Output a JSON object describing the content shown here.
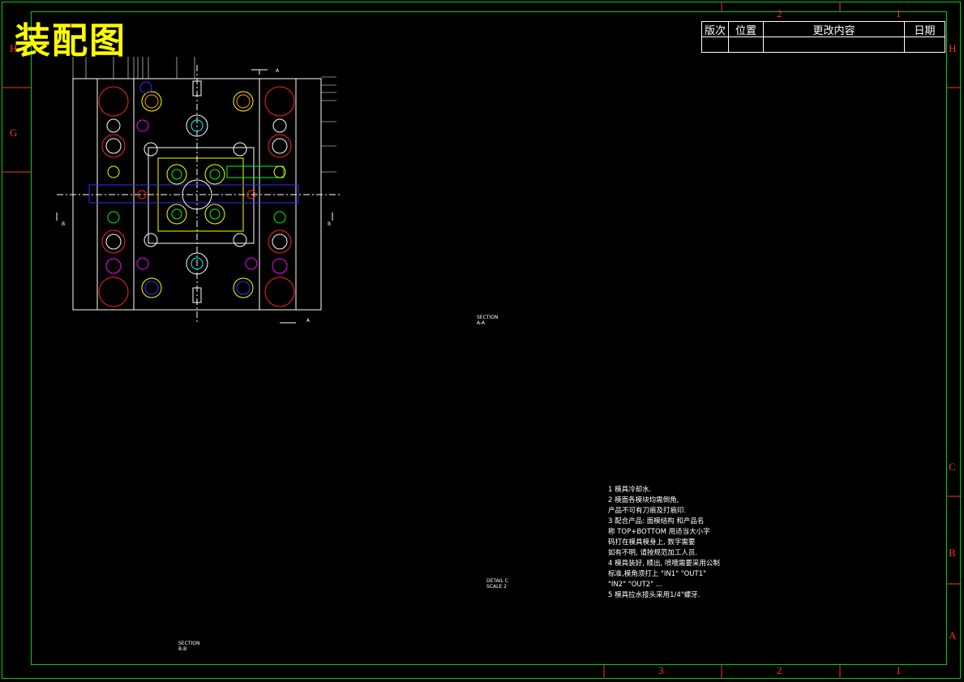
{
  "drawing_title": "装配图",
  "revision_header": [
    "版次",
    "位置",
    "更改内容",
    "日期"
  ],
  "zone_letters_left": [
    "H",
    "G"
  ],
  "zone_letters_right": [
    "H",
    "C",
    "B",
    "A"
  ],
  "zone_numbers_top": [
    "2",
    "1"
  ],
  "zone_numbers_bottom": [
    "3",
    "2",
    "1"
  ],
  "view_labels": {
    "section_aa": "SECTION\nA-A",
    "section_bb": "SECTION\nB-B",
    "detail_c": "DETAIL C\nSCALE 2"
  },
  "cut_markers": {
    "a": "A",
    "b": "B"
  },
  "notes": [
    "1  模具冷却水.",
    "2  模面各模块均需倒角,",
    "    产品不可有刀痕及打痕印.",
    "3  配合产品:   面模结构  和产品名",
    "    称 TOP+BOTTOM  用适当大小字",
    "    码打在模具模身上, 数字需要",
    "    如有不明, 请按规范加工人员.",
    "4  模具装好, 顺出, 喷哦需要采用公制",
    "    标准,模角须打上 \"IN1\" \"OUT1\"",
    "    \"IN2\" \"OUT2\" ...",
    "5  模具拉水接头采用1/4\"螺牙."
  ],
  "colors": {
    "frame": "#00d000",
    "title": "#ffff00",
    "zone": "#ff3030",
    "leader": "#00ff00",
    "outline": "#ffffff",
    "hatch": "#7a7a7a",
    "cyan": "#00ffff",
    "magenta": "#ff00ff",
    "yellow": "#ffff00",
    "red": "#ff2020",
    "blue": "#3030ff",
    "orange": "#ff9900"
  }
}
